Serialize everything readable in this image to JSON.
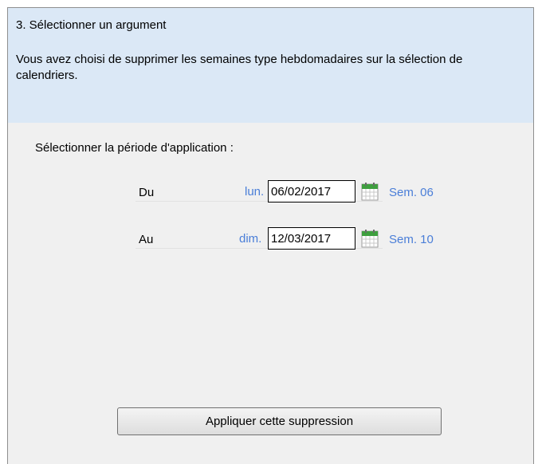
{
  "step": {
    "title": "3. Sélectionner un argument"
  },
  "description": "Vous avez choisi de supprimer les semaines type hebdomadaires sur la sélection de calendriers.",
  "period": {
    "label": "Sélectionner la période d'application :",
    "from": {
      "label": "Du",
      "day": "lun.",
      "date": "06/02/2017",
      "week": "Sem. 06"
    },
    "to": {
      "label": "Au",
      "day": "dim.",
      "date": "12/03/2017",
      "week": "Sem. 10"
    }
  },
  "actions": {
    "apply": "Appliquer cette suppression"
  },
  "colors": {
    "header_bg": "#dbe8f6",
    "panel_bg": "#f0f0f0",
    "accent_text": "#4a7ed8",
    "calendar_green": "#3f9f3f"
  },
  "icons": {
    "calendar": "calendar-icon"
  }
}
